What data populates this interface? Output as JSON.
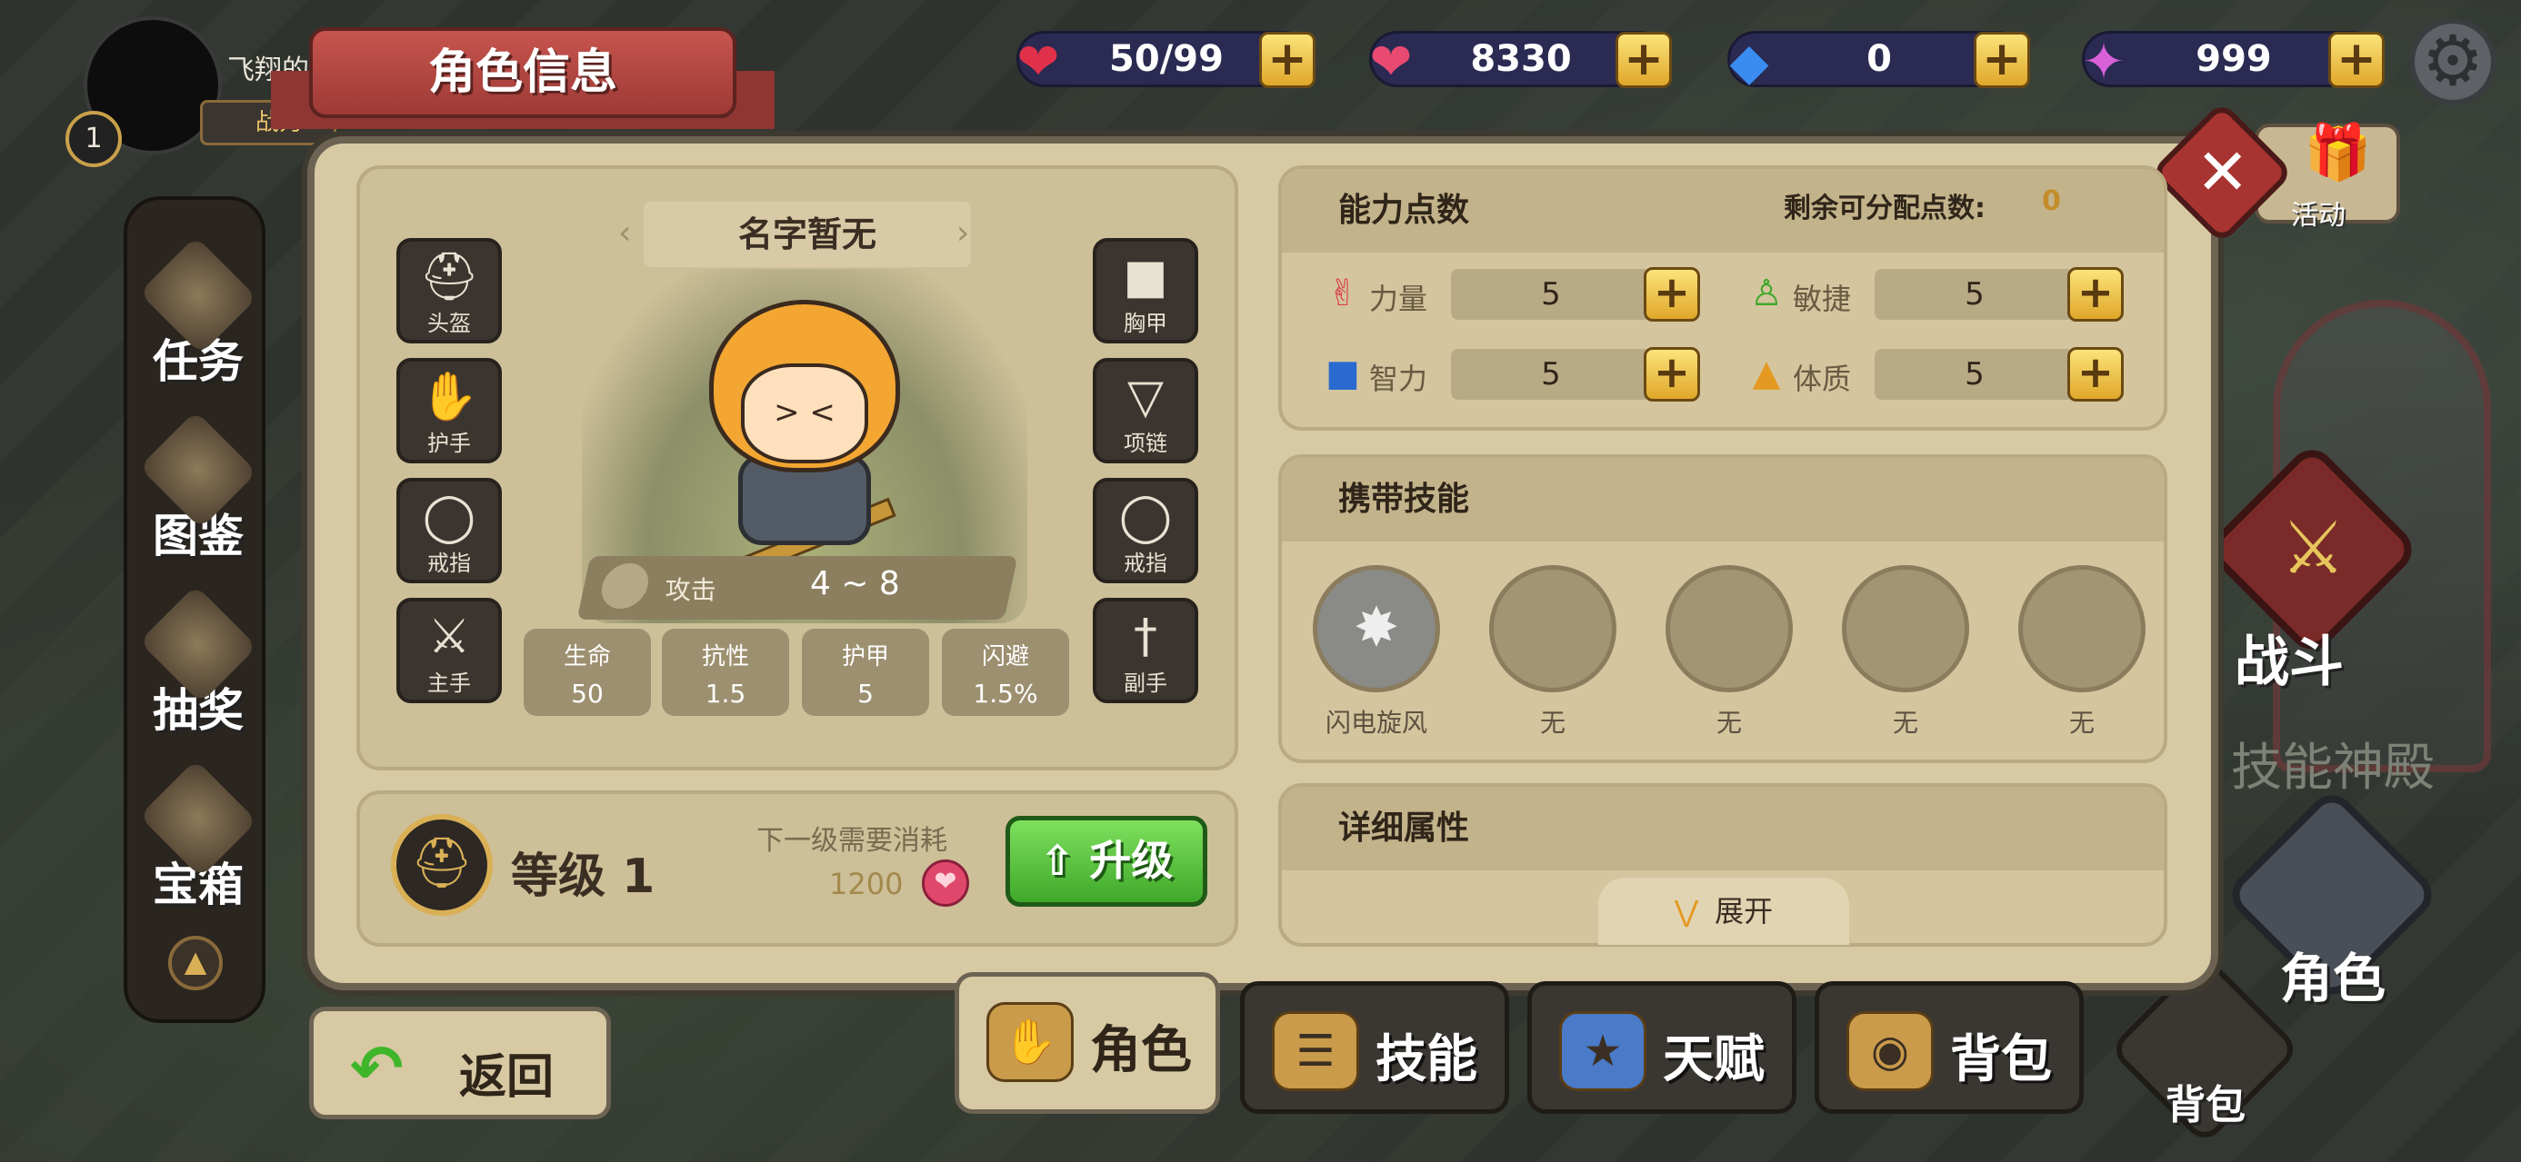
{
  "top_bar": {
    "player_name": "飞翔的荷兰人",
    "power_label": "战力",
    "player_level": "1",
    "resources": [
      {
        "name": "stamina",
        "icon": "heart-icon",
        "value": "50/99"
      },
      {
        "name": "gold",
        "icon": "pink-heart-coin-icon",
        "value": "8330"
      },
      {
        "name": "diamond",
        "icon": "blue-diamond-icon",
        "value": "0"
      },
      {
        "name": "gem",
        "icon": "rainbow-gem-icon",
        "value": "999"
      }
    ]
  },
  "panel": {
    "title": "角色信息",
    "activity_label": "活动",
    "character": {
      "name": "名字暂无",
      "attack_label": "攻击",
      "attack_value": "4 ~ 8",
      "equipment_left": [
        "头盔",
        "护手",
        "戒指",
        "主手"
      ],
      "equipment_right": [
        "胸甲",
        "项链",
        "戒指",
        "副手"
      ],
      "stats": [
        {
          "label": "生命",
          "value": "50"
        },
        {
          "label": "抗性",
          "value": "1.5"
        },
        {
          "label": "护甲",
          "value": "5"
        },
        {
          "label": "闪避",
          "value": "1.5%"
        }
      ]
    },
    "level": {
      "text": "等级 1",
      "next_cost_label": "下一级需要消耗",
      "next_cost_value": "1200",
      "upgrade_label": "升级"
    },
    "ability": {
      "title": "能力点数",
      "remaining_label": "剩余可分配点数:",
      "remaining_value": "0",
      "attrs": [
        {
          "label": "力量",
          "value": "5",
          "icon": "arm-icon"
        },
        {
          "label": "敏捷",
          "value": "5",
          "icon": "running-icon"
        },
        {
          "label": "智力",
          "value": "5",
          "icon": "book-icon"
        },
        {
          "label": "体质",
          "value": "5",
          "icon": "armor-icon"
        }
      ]
    },
    "skills": {
      "title": "携带技能",
      "slots": [
        "闪电旋风",
        "无",
        "无",
        "无",
        "无"
      ]
    },
    "details": {
      "title": "详细属性",
      "expand_label": "展开"
    }
  },
  "sidebar": {
    "items": [
      "任务",
      "图鉴",
      "抽奖",
      "宝箱"
    ]
  },
  "bottom_tabs": [
    "角色",
    "技能",
    "天赋",
    "背包"
  ],
  "back_label": "返回",
  "world": {
    "battle_label": "战斗",
    "skill_temple_label": "技能神殿",
    "role_label": "角色",
    "bag_label": "背包"
  }
}
